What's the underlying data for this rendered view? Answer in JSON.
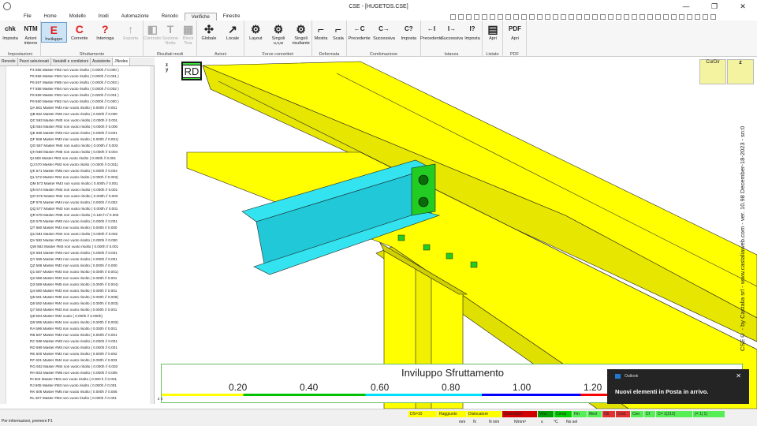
{
  "window": {
    "title": "CSE - [HUGETOS.CSE]",
    "min": "—",
    "max": "❐",
    "close": "✕"
  },
  "menu": [
    "File",
    "Home",
    "Modello",
    "Inodi",
    "Automazione",
    "Renodo",
    "Verifiche",
    "Finestre"
  ],
  "active_menu": "Verifiche",
  "ribbon": {
    "groups": [
      {
        "label": "Impostazioni",
        "buttons": [
          {
            "icon": "chk",
            "label": "Imposta"
          },
          {
            "icon": "NTM",
            "label": "Azioni interne"
          }
        ]
      },
      {
        "label": "Sfruttamento",
        "buttons": [
          {
            "icon": "E",
            "label": "Inviluppo"
          },
          {
            "icon": "C",
            "label": "Corrente"
          },
          {
            "icon": "?",
            "label": "Interroga"
          },
          {
            "icon": "↑",
            "label": "Esporta"
          }
        ]
      },
      {
        "label": "Risultati modi",
        "buttons": [
          {
            "icon": "◧",
            "label": "Contratto"
          },
          {
            "icon": "T",
            "label": "Sezione Netta"
          },
          {
            "icon": "▦",
            "label": "Block Tear"
          }
        ]
      },
      {
        "label": "Azioni",
        "buttons": [
          {
            "icon": "✣",
            "label": "Globale"
          },
          {
            "icon": "↗",
            "label": "Locale"
          }
        ]
      },
      {
        "label": "Forze connettori",
        "buttons": [
          {
            "icon": "⚙",
            "label": "Layout"
          },
          {
            "icon": "⚙",
            "label": "Singoli u,v,w"
          },
          {
            "icon": "⚙",
            "label": "Singoli risultante"
          }
        ]
      },
      {
        "label": "Deformata",
        "buttons": [
          {
            "icon": "⌐",
            "label": "Mostra"
          },
          {
            "icon": "⌐",
            "label": "Scala"
          }
        ]
      },
      {
        "label": "Combinazione",
        "buttons": [
          {
            "icon": "←C",
            "label": "Precedente"
          },
          {
            "icon": "C→",
            "label": "Successiva"
          },
          {
            "icon": "C?",
            "label": "Imposta"
          }
        ]
      },
      {
        "label": "Istanza",
        "buttons": [
          {
            "icon": "←I",
            "label": "Precedente"
          },
          {
            "icon": "I→",
            "label": "Successiva"
          },
          {
            "icon": "I?",
            "label": "Imposta"
          }
        ]
      },
      {
        "label": "Listato",
        "buttons": [
          {
            "icon": "▤",
            "label": "Apri"
          }
        ]
      },
      {
        "label": "PDF",
        "buttons": [
          {
            "icon": "PDF",
            "label": "Apri"
          }
        ]
      }
    ]
  },
  "panel_tabs": [
    "Renodo",
    "Pezzi selezionati",
    "Variabili e condizioni",
    "Assistente",
    "JNodes"
  ],
  "active_panel_tab": "JNodes",
  "rows": [
    {
      "t": "P4 555 Master #M2 non vuoto risolto ( 0.000h // 0.000 )",
      "c": "#00b050"
    },
    {
      "t": "P5 556 Master #M3 non vuoto risolto ( 0.000h // 0.001 )",
      "c": "#00b050"
    },
    {
      "t": "P6 557 Master #M5 non vuoto risolto ( 0.000h // 0.003 )",
      "c": "#0000ff"
    },
    {
      "t": "P7 558 Master #M4 non vuoto risolto ( 0.000h // 0.002 )",
      "c": "#00b050"
    },
    {
      "t": "P8 559 Master #M3 non vuoto risolto ( 0.000h // 0.001 )",
      "c": "#00ffff"
    },
    {
      "t": "P9 560 Master #M2 non vuoto risolto ( 0.000h // 0.000 )",
      "c": "#007a2c"
    },
    {
      "t": "QA 561 Master #M3 non vuoto risolto ( 0.000h // 0.001",
      "c": "#00ffff"
    },
    {
      "t": "QB 562 Master #M2 non vuoto risolto ( 0.000h // 0.000",
      "c": "#00ffff"
    },
    {
      "t": "QC 563 Master #M3 non vuoto risolto ( 0.000h // 0.001",
      "c": "#00ffff"
    },
    {
      "t": "QD 564 Master #M2 non vuoto risolto ( 0.000h // 0.000",
      "c": "#007a2c"
    },
    {
      "t": "QE 565 Master #M3 non vuoto risolto ( 0.000h // 0.001",
      "c": "#00ffff"
    },
    {
      "t": "QF 566 Master #M3 non vuoto risolto ( 0.000h // 0.001)",
      "c": "#00ffff"
    },
    {
      "t": "QG 567 Master #M4 non vuoto risolto ( 0.000h // 0.003",
      "c": "#007a2c"
    },
    {
      "t": "QH 568 Master #M5 non vuoto risolto ( 0.000h // 0.004",
      "c": "#0000ff"
    },
    {
      "t": "QI 569 Master #M3 non vuoto risolto ( 0.000h // 0.001",
      "c": "#00ffff"
    },
    {
      "t": "QJ 570 Master #M3 non vuoto risolto ( 0.000h // 0.001)",
      "c": "#00ffff"
    },
    {
      "t": "QK 571 Master #M5 non vuoto risolto ( 0.000h // 0.004",
      "c": "#0000ff"
    },
    {
      "t": "QL 572 Master #M4 non vuoto risolto ( 0.000h // 0.003)",
      "c": "#0000ff"
    },
    {
      "t": "QM 573 Master #M3 non vuoto risolto ( 0.000h // 0.001",
      "c": "#00ffff"
    },
    {
      "t": "QN 574 Master #M3 non vuoto risolto ( 0.000h // 0.001",
      "c": "#00ffff"
    },
    {
      "t": "QO 575 Master #M4 non vuoto risolto ( 0.000h // 0.003",
      "c": "#0000ff"
    },
    {
      "t": "QP 576 Master #M4 non vuoto risolto ( 0.000h // 0.003",
      "c": "#0000ff"
    },
    {
      "t": "QQ 577 Master #M3 non vuoto risolto ( 0.000h // 0.001",
      "c": "#00ffff"
    },
    {
      "t": "QR 578 Master #M5 non vuoto risolto ( 0.150 h // 0.003",
      "c": "#007a2c"
    },
    {
      "t": "QS 579 Master #M3 non vuoto risolto ( 0.000h // 0.001",
      "c": "#00ffff"
    },
    {
      "t": "QT 580 Master #M2 non vuoto risolto ( 0.000h // 0.000",
      "c": "#00ffff"
    },
    {
      "t": "QU 581 Master #M4 non vuoto risolto ( 0.000h // 0.002",
      "c": "#0000ff"
    },
    {
      "t": "QV 582 Master #M2 non vuoto risolto ( 0.000h // 0.000",
      "c": "#00ffff"
    },
    {
      "t": "QW 583 Master #M3 non vuoto risolto ( 0.000h // 0.001",
      "c": "#007a2c"
    },
    {
      "t": "QX 584 Master #M3 non vuoto risolto ( 0.000h // 0.001",
      "c": "#00ffff"
    },
    {
      "t": "QY 585 Master #M2 non vuoto risolto ( 0.000h // 0.001",
      "c": "#00ffff"
    },
    {
      "t": "QZ 586 Master #M2 non vuoto risolto ( 0.000h // 0.000",
      "c": "#00b050"
    },
    {
      "t": "Q1 587 Master #M3 non vuoto risolto ( 0.000h // 0.001)",
      "c": "#00ffff"
    },
    {
      "t": "Q2 588 Master #M3 non vuoto risolto ( 0.000h // 0.001",
      "c": "#0000ff"
    },
    {
      "t": "Q3 589 Master #M5 non vuoto risolto ( 0.000h // 0.004)",
      "c": "#0000ff"
    },
    {
      "t": "Q4 590 Master #M3 non vuoto risolto ( 0.000h // 0.001",
      "c": "#00ffff"
    },
    {
      "t": "Q5 591 Master #M6 non vuoto risolto ( 0.000h // 0.009)",
      "c": "#0000ff"
    },
    {
      "t": "Q6 592 Master #M4 non vuoto risolto ( 0.000h // 0.003)",
      "c": "#0000ff"
    },
    {
      "t": "Q7 593 Master #M3 non vuoto risolto ( 0.000h // 0.001",
      "c": "#00ffff"
    },
    {
      "t": "Q8 594 Master #M2 vuoto ( 0.000h // 0.000h)",
      "c": "#ffffff"
    },
    {
      "t": "Q9 595 Master #M4 non vuoto risolto ( 0.000h // 0.003)",
      "c": "#0000ff"
    },
    {
      "t": "RA 596 Master #M3 non vuoto risolto ( 0.000h // 0.001",
      "c": "#00ffff"
    },
    {
      "t": "RB 597 Master #M3 non vuoto risolto ( 0.000h // 0.001",
      "c": "#00ffff"
    },
    {
      "t": "RC 598 Master #M3 non vuoto risolto ( 0.000h // 0.001",
      "c": "#007a2c"
    },
    {
      "t": "RD 599 Master #M3 non vuoto risolto ( 0.000h // 0.001",
      "c": "#ffffff",
      "pre": "sel"
    },
    {
      "t": "RE 600 Master #M2 non vuoto risolto ( 0.000h // 0.002",
      "c": "#00ffff"
    },
    {
      "t": "RF 601 Master #M4 non vuoto risolto ( 0.000h // 0.003",
      "c": "#0000ff"
    },
    {
      "t": "RG 602 Master #M4 non vuoto risolto ( 0.000h // 0.003",
      "c": "#0000ff"
    },
    {
      "t": "RH 603 Master #M5 non vuoto risolto ( 0.000h // 0.005",
      "c": "#0000ff"
    },
    {
      "t": "RI 604 Master #M3 non vuoto risolto ( 0.000 h // 0.001",
      "c": "#00ffff"
    },
    {
      "t": "RJ 605 Master #M3 non vuoto risolto ( 0.000h // 0.001",
      "c": "#00ffff"
    },
    {
      "t": "RK 606 Master #M5 non vuoto risolto ( 0.000h // 0.005",
      "c": "#0000ff"
    },
    {
      "t": "RL 607 Master #M3 non vuoto risolto ( 0.000h // 0.001",
      "c": "#00ffff"
    }
  ],
  "viewport": {
    "badge": "RD",
    "axis_z": "z",
    "axis_y": "y",
    "axis_x": "x",
    "curdir": "CurDir",
    "vertical_text": "CSE© - by Castalia srl - www.castaliaweb.com - ver. 10.98 December-18-2023 - sn:0",
    "beam_color": "#ffff00",
    "member_color": "#33e4f0",
    "plate_color": "#22cc22"
  },
  "legend": {
    "title": "Inviluppo Sfruttamento",
    "ticks": [
      "0.20",
      "0.40",
      "0.60",
      "0.80",
      "1.00",
      "1.20"
    ]
  },
  "toast": {
    "app": "Outlook",
    "message": "Nuovi elementi in Posta in arrivo.",
    "close": "✕"
  },
  "statusbar": {
    "info": "Per informazioni, premere F1",
    "cells": [
      {
        "t": "DS=10",
        "c": "#ffff00"
      },
      {
        "t": "Raggiunto",
        "c": "#ffff00"
      },
      {
        "t": "Dislocatore",
        "c": "#ffff00"
      },
      {
        "t": "Connettori",
        "c": "#d00000"
      },
      {
        "t": "Vinc",
        "c": "#00a000"
      },
      {
        "t": "Comp",
        "c": "#00d000"
      },
      {
        "t": "Fin",
        "c": "#55ee55"
      },
      {
        "t": "Med",
        "c": "#55ee55"
      },
      {
        "t": "Gli",
        "c": "#e03030"
      },
      {
        "t": "Cost",
        "c": "#e03030"
      },
      {
        "t": "Cen",
        "c": "#55ee55"
      },
      {
        "t": "Cf",
        "c": "#55ee55"
      },
      {
        "t": "C= 1(212)",
        "c": "#55ee55"
      },
      {
        "t": "(= 1| 1)",
        "c": "#55ee55"
      }
    ],
    "units": [
      "mm",
      "N",
      "N mm",
      "N/mm²",
      "s",
      "°C",
      "No sel"
    ]
  }
}
